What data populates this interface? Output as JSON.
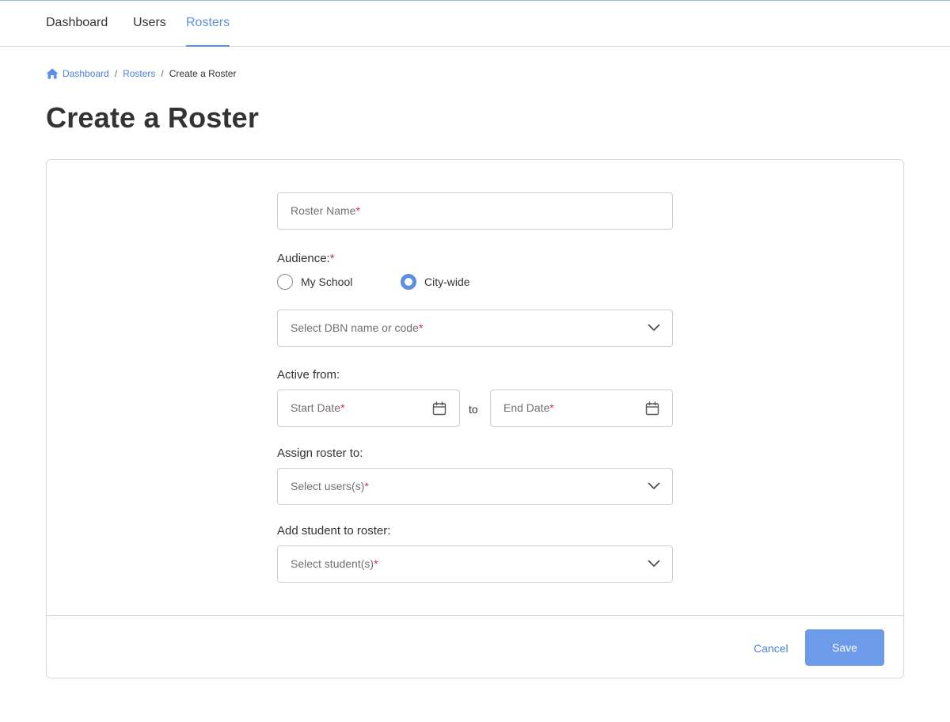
{
  "nav": {
    "tabs": [
      {
        "label": "Dashboard"
      },
      {
        "label": "Users"
      },
      {
        "label": "Rosters"
      }
    ],
    "active_tab": "Rosters"
  },
  "breadcrumb": {
    "home": "Dashboard",
    "rosters": "Rosters",
    "current": "Create a Roster",
    "separator": "/"
  },
  "page": {
    "title": "Create a Roster"
  },
  "form": {
    "roster_name": {
      "placeholder": "Roster Name",
      "value": ""
    },
    "audience": {
      "label": "Audience:",
      "options": [
        {
          "label": "My School",
          "checked": false
        },
        {
          "label": "City-wide",
          "checked": true
        }
      ]
    },
    "dbn": {
      "placeholder": "Select DBN name or code",
      "value": ""
    },
    "active_from": {
      "label": "Active from:",
      "start_placeholder": "Start Date",
      "to": "to",
      "end_placeholder": "End Date"
    },
    "assign": {
      "label": "Assign roster to:",
      "placeholder": "Select users(s)"
    },
    "students": {
      "label": "Add student to roster:",
      "placeholder": "Select student(s)"
    },
    "required_marker": "*"
  },
  "footer": {
    "cancel_label": "Cancel",
    "save_label": "Save"
  },
  "colors": {
    "accent": "#5b8fe6",
    "required": "#d6294f",
    "save_button": "#6b9be9"
  },
  "icons": {
    "home": "home-icon",
    "chevron": "chevron-down-icon",
    "calendar": "calendar-icon"
  }
}
